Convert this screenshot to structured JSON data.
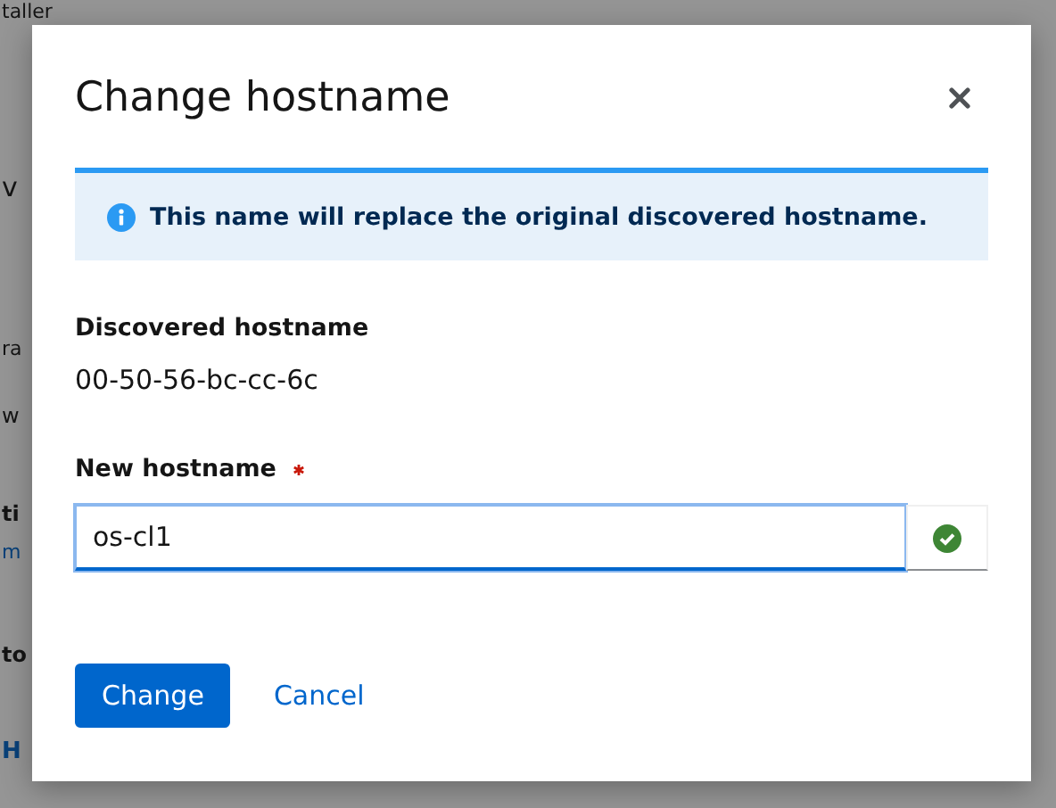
{
  "background": {
    "fragments": [
      {
        "text": "taller"
      },
      {
        "text": "v"
      },
      {
        "text": "ra"
      },
      {
        "text": "w"
      },
      {
        "text": "ti"
      },
      {
        "text": "m"
      },
      {
        "text": "to"
      },
      {
        "text": "H"
      }
    ]
  },
  "dialog": {
    "title": "Change hostname",
    "alert": {
      "text": "This name will replace the original discovered hostname."
    },
    "discovered": {
      "label": "Discovered hostname",
      "value": "00-50-56-bc-cc-6c"
    },
    "new_hostname": {
      "label": "New hostname",
      "required": true,
      "value": "os-cl1",
      "valid": true
    },
    "buttons": [
      {
        "label": "Change",
        "kind": "primary"
      },
      {
        "label": "Cancel",
        "kind": "link"
      }
    ]
  }
}
